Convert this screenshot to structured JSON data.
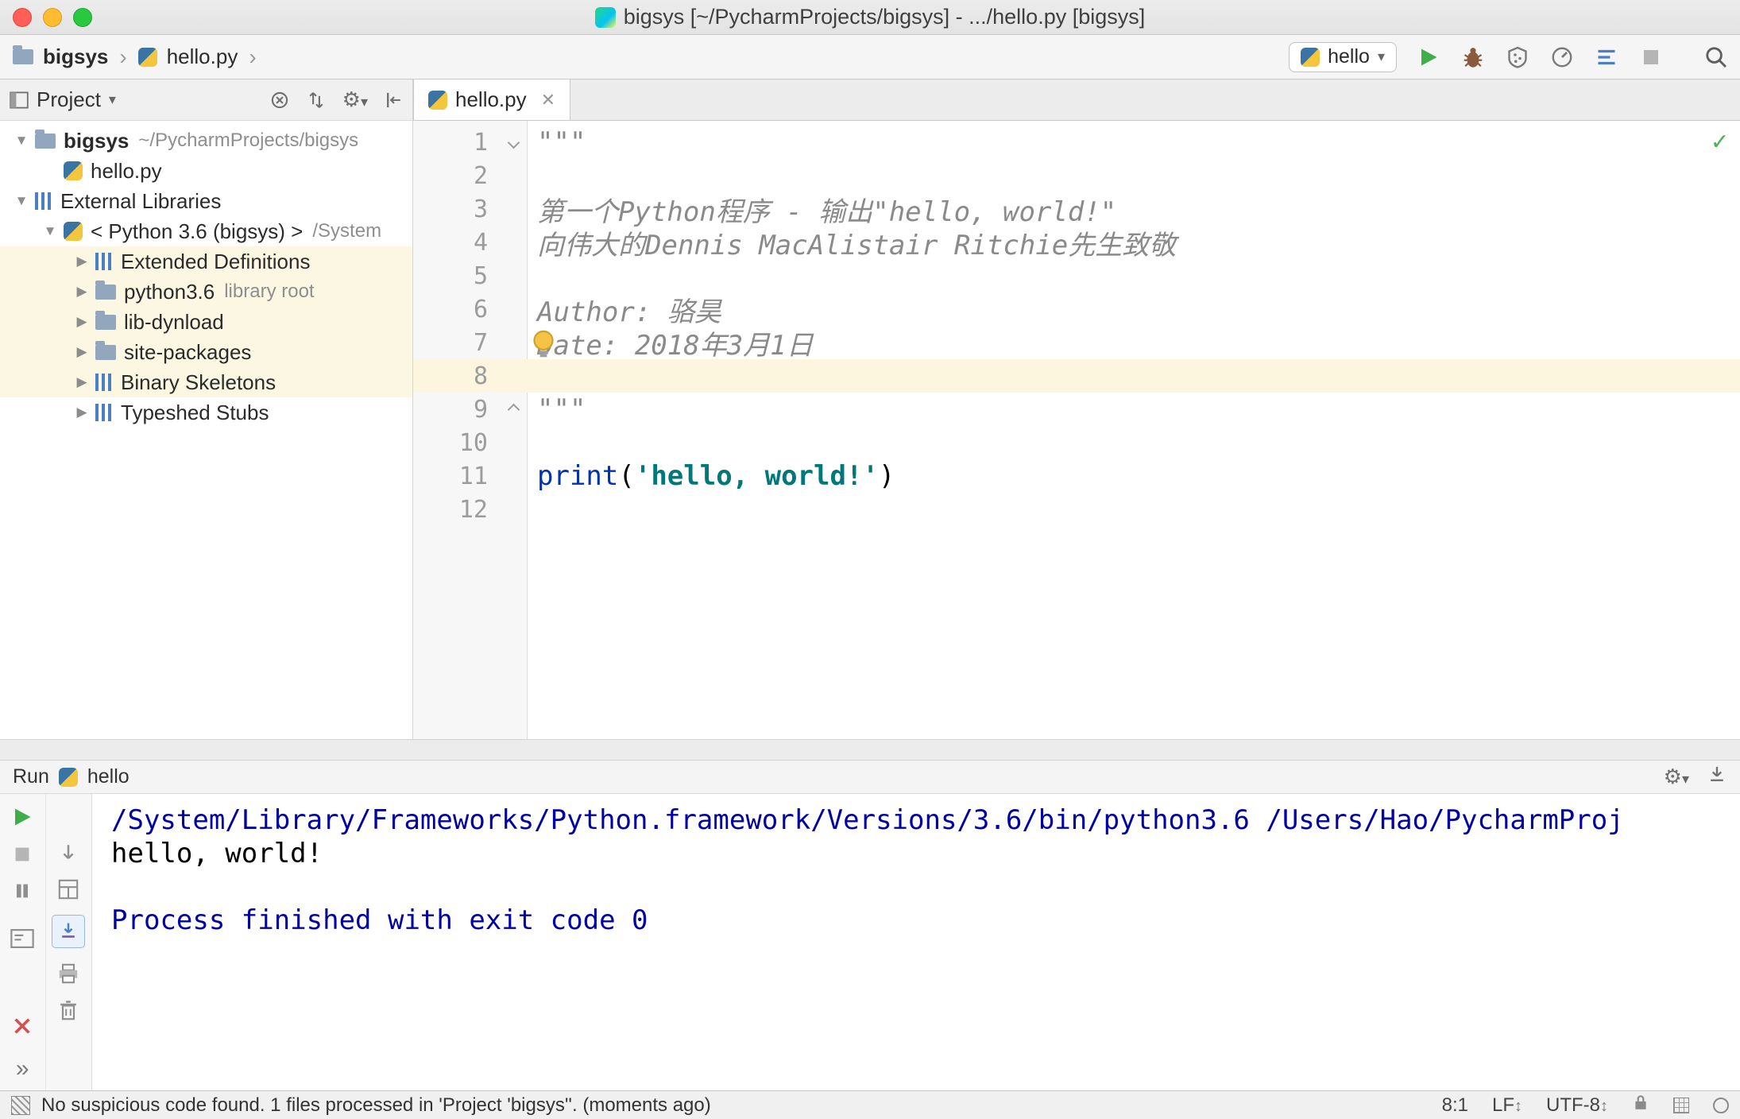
{
  "titlebar": {
    "title": "bigsys [~/PycharmProjects/bigsys] - .../hello.py [bigsys]"
  },
  "toolbar": {
    "breadcrumb": [
      "bigsys",
      "hello.py"
    ],
    "run_config": "hello"
  },
  "project": {
    "header": "Project",
    "tree": [
      {
        "indent": 0,
        "arrow": "down",
        "icon": "folder",
        "label": "bigsys",
        "bold": true,
        "suffix": "~/PycharmProjects/bigsys",
        "highlight": false
      },
      {
        "indent": 1,
        "arrow": "none",
        "icon": "python-file",
        "label": "hello.py",
        "highlight": false
      },
      {
        "indent": 0,
        "arrow": "down",
        "icon": "library",
        "label": "External Libraries",
        "highlight": false
      },
      {
        "indent": 1,
        "arrow": "down",
        "icon": "python-sdk",
        "label": "< Python 3.6 (bigsys) >",
        "suffix": "/System",
        "highlight": false
      },
      {
        "indent": 2,
        "arrow": "right",
        "icon": "library",
        "label": "Extended Definitions",
        "highlight": true
      },
      {
        "indent": 2,
        "arrow": "right",
        "icon": "folder",
        "label": "python3.6",
        "suffix": "library root",
        "highlight": true
      },
      {
        "indent": 2,
        "arrow": "right",
        "icon": "folder",
        "label": "lib-dynload",
        "highlight": true
      },
      {
        "indent": 2,
        "arrow": "right",
        "icon": "folder",
        "label": "site-packages",
        "highlight": true
      },
      {
        "indent": 2,
        "arrow": "right",
        "icon": "library",
        "label": "Binary Skeletons",
        "highlight": true
      },
      {
        "indent": 2,
        "arrow": "right",
        "icon": "library",
        "label": "Typeshed Stubs",
        "highlight": false
      }
    ]
  },
  "editor": {
    "tab": "hello.py",
    "lines": [
      {
        "num": "1",
        "fold": "start",
        "segments": [
          {
            "t": "\"\"\"",
            "c": "doc"
          }
        ]
      },
      {
        "num": "2",
        "segments": []
      },
      {
        "num": "3",
        "segments": [
          {
            "t": "第一个Python程序 - 输出\"hello, world!\"",
            "c": "doc"
          }
        ]
      },
      {
        "num": "4",
        "segments": [
          {
            "t": "向伟大的Dennis MacAlistair Ritchie先生致敬",
            "c": "doc"
          }
        ]
      },
      {
        "num": "5",
        "segments": []
      },
      {
        "num": "6",
        "segments": [
          {
            "t": "Author: 骆昊",
            "c": "doc"
          }
        ]
      },
      {
        "num": "7",
        "segments": [
          {
            "t": "Date: 2018年3月1日",
            "c": "doc"
          }
        ]
      },
      {
        "num": "8",
        "current": true,
        "segments": []
      },
      {
        "num": "9",
        "fold": "end",
        "segments": [
          {
            "t": "\"\"\"",
            "c": "doc"
          }
        ]
      },
      {
        "num": "10",
        "segments": []
      },
      {
        "num": "11",
        "segments": [
          {
            "t": "print",
            "c": "kw"
          },
          {
            "t": "(",
            "c": "plain"
          },
          {
            "t": "'hello, world!'",
            "c": "str"
          },
          {
            "t": ")",
            "c": "plain"
          }
        ]
      },
      {
        "num": "12",
        "segments": []
      }
    ]
  },
  "run": {
    "title": "Run",
    "process": "hello",
    "output": [
      {
        "t": "/System/Library/Frameworks/Python.framework/Versions/3.6/bin/python3.6 /Users/Hao/PycharmProj",
        "c": "sys"
      },
      {
        "t": "hello, world!",
        "c": "out"
      },
      {
        "t": "",
        "c": "out"
      },
      {
        "t": "Process finished with exit code 0",
        "c": "sys"
      }
    ]
  },
  "statusbar": {
    "message": "No suspicious code found. 1 files processed in 'Project 'bigsys''. (moments ago)",
    "caret": "8:1",
    "line_sep": "LF",
    "encoding": "UTF-8"
  },
  "colors": {
    "doc": "#8a8a8a",
    "kw": "#0033b3",
    "str": "#00787a",
    "plain": "#000000",
    "sys": "#0000a8",
    "out": "#000000",
    "run_green": "#3fae4a",
    "tree_highlight": "#fbf7e2",
    "current_line": "#fcf6de",
    "check_green": "#4db24d"
  }
}
